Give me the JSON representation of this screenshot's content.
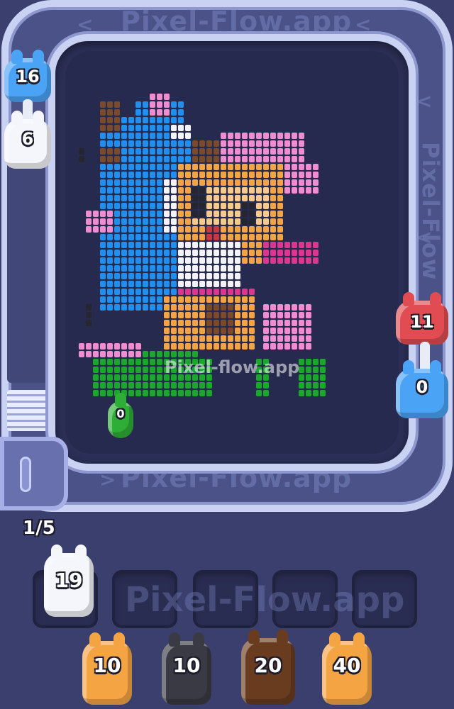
{
  "watermarks": {
    "track_top": "Pixel-Flow.app",
    "track_bottom": "Pixel-Flow.app",
    "track_right": "Pixel-Flow",
    "board_center": "Pixel-flow.app",
    "slots_center": "Pixel-Flow.app"
  },
  "track_chevron": "<",
  "track_chevron_right": ">",
  "launcher": {
    "progress": "1/5"
  },
  "queue_left": [
    {
      "count": "16",
      "color": "#4aa3f5"
    },
    {
      "count": "6",
      "color": "#f4f6fb"
    }
  ],
  "queue_right": [
    {
      "count": "11",
      "color": "#e04c52"
    },
    {
      "count": "0",
      "color": "#4aa3f5"
    }
  ],
  "on_board_critter": {
    "count": "0",
    "color": "#2fae37"
  },
  "active_critter": {
    "count": "19",
    "color": "#f4f6fb"
  },
  "bottom_queue": [
    {
      "count": "10",
      "color": "#f5a443"
    },
    {
      "count": "10",
      "color": "#3a3a44"
    },
    {
      "count": "20",
      "color": "#6a3c1f"
    },
    {
      "count": "40",
      "color": "#f5a443"
    }
  ],
  "colors": {
    "blue": "#1f8ff0",
    "white": "#f4f4f8",
    "pink": "#f08ccf",
    "magenta": "#e0358e",
    "brown": "#7a4a2a",
    "orange": "#f5a443",
    "peach": "#f7c98b",
    "black": "#262630",
    "green": "#19a82a",
    "red": "#c8393f"
  }
}
